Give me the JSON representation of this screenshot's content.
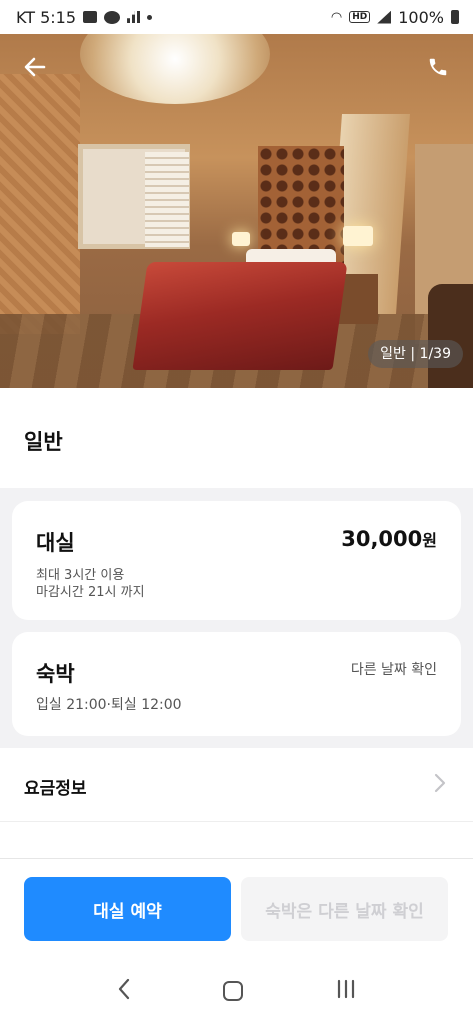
{
  "status_bar": {
    "left_text": "KT 5:15",
    "battery": "100%",
    "icons": [
      "image-icon",
      "talk-icon",
      "signal-bars-icon",
      "dot-icon",
      "wifi-icon",
      "hd-icon",
      "cell-signal-icon",
      "battery-icon"
    ]
  },
  "hero": {
    "photo_counter": "일반 | 1/39",
    "back_icon": "arrow-left-icon",
    "phone_icon": "phone-icon"
  },
  "room": {
    "title": "일반"
  },
  "daesil": {
    "title": "대실",
    "price": "30,000",
    "price_unit": "원",
    "max_time": "최대 3시간 이용",
    "deadline": "마감시간 21시 까지"
  },
  "sukbak": {
    "title": "숙박",
    "check_other": "다른 날짜 확인",
    "time": "입실 21:00·퇴실 12:00"
  },
  "rate_info": {
    "label": "요금정보"
  },
  "actions": {
    "primary": "대실 예약",
    "secondary": "숙박은 다른 날짜 확인"
  },
  "colors": {
    "primary": "#1f8bff",
    "disabled_bg": "#f4f4f5",
    "page_bg": "#f2f2f4"
  }
}
